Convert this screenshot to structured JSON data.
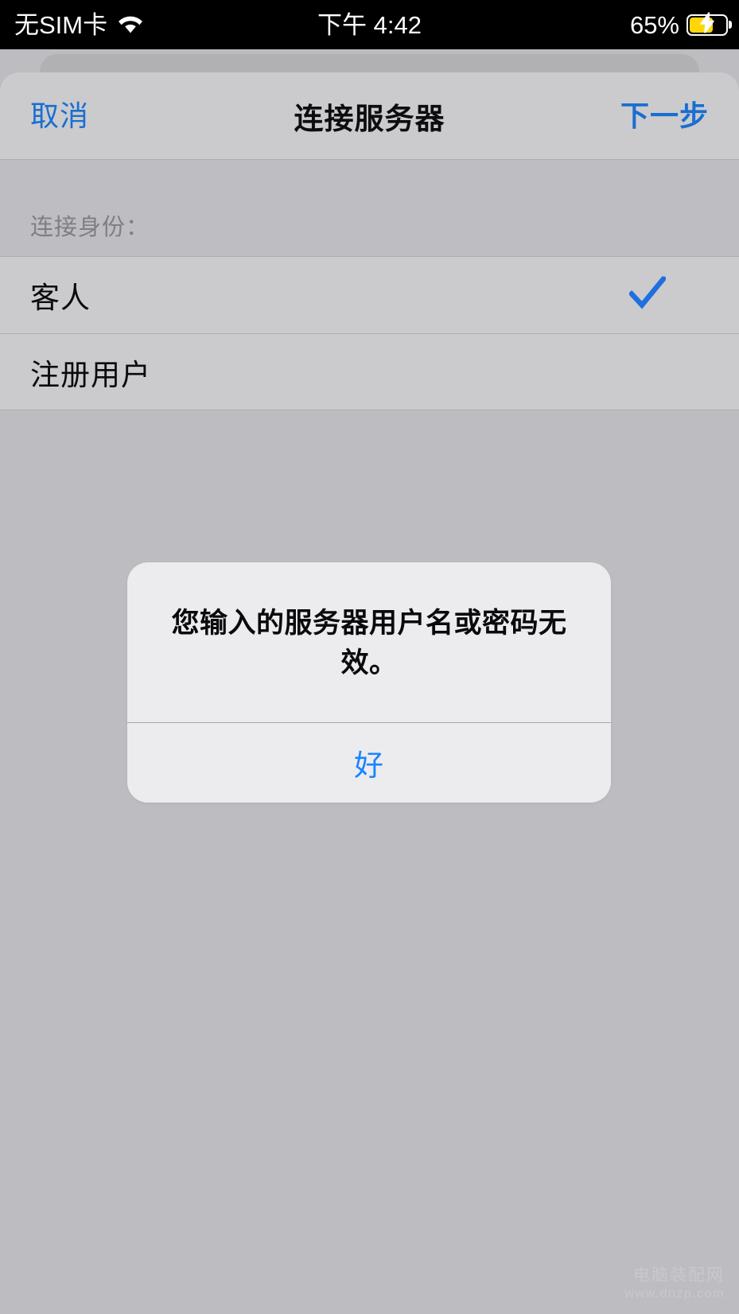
{
  "status_bar": {
    "carrier": "无SIM卡",
    "wifi_icon": "wifi-icon",
    "time": "下午 4:42",
    "battery_percent": "65%",
    "battery_level": 65,
    "battery_icon": "battery-charging-icon",
    "bolt_icon": "lightning-bolt-icon",
    "background_color": "#000000",
    "text_color": "#ffffff",
    "battery_fill_color": "#ffd60a"
  },
  "nav_bar": {
    "cancel_label": "取消",
    "title": "连接服务器",
    "next_label": "下一步",
    "tint_color": "#1a6ed1",
    "background_color": "#cbcbcd"
  },
  "form": {
    "section_header": "连接身份：",
    "options": [
      {
        "label": "客人",
        "selected": true,
        "check_icon": "checkmark-icon"
      },
      {
        "label": "注册用户",
        "selected": false,
        "check_icon": ""
      }
    ],
    "check_color": "#1f6fe0",
    "row_background_color": "#cbcbcd",
    "page_background_color": "#bcbcc1"
  },
  "alert": {
    "message": "您输入的服务器用户名或密码无效。",
    "ok_label": "好",
    "ok_color": "#1a84ff",
    "background_color": "#ececee"
  },
  "watermark": {
    "title": "电脑装配网",
    "url": "www.dnzp.com",
    "color": "#c9c9cd"
  }
}
